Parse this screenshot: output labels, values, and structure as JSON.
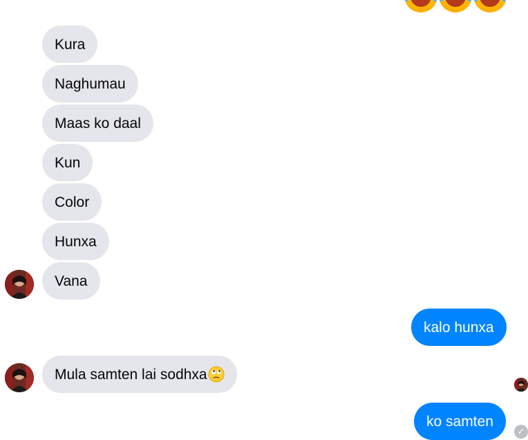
{
  "top_reaction_emojis": [
    "laughing-face-icon",
    "laughing-face-icon",
    "laughing-face-icon"
  ],
  "incoming_group_1": [
    {
      "text": "Kura"
    },
    {
      "text": "Naghumau"
    },
    {
      "text": "Maas ko daal"
    },
    {
      "text": "Kun"
    },
    {
      "text": "Color"
    },
    {
      "text": "Hunxa"
    },
    {
      "text": "Vana"
    }
  ],
  "outgoing_1": {
    "text": "kalo hunxa"
  },
  "incoming_2": {
    "text": "Mula samten lai sodhxa",
    "emoji": "eye-roll-emoji-icon"
  },
  "outgoing_2": {
    "text": "ko samten"
  },
  "colors": {
    "incoming_bubble": "#e4e6eb",
    "outgoing_bubble": "#0084ff",
    "sent_check": "#bcc0c4"
  }
}
